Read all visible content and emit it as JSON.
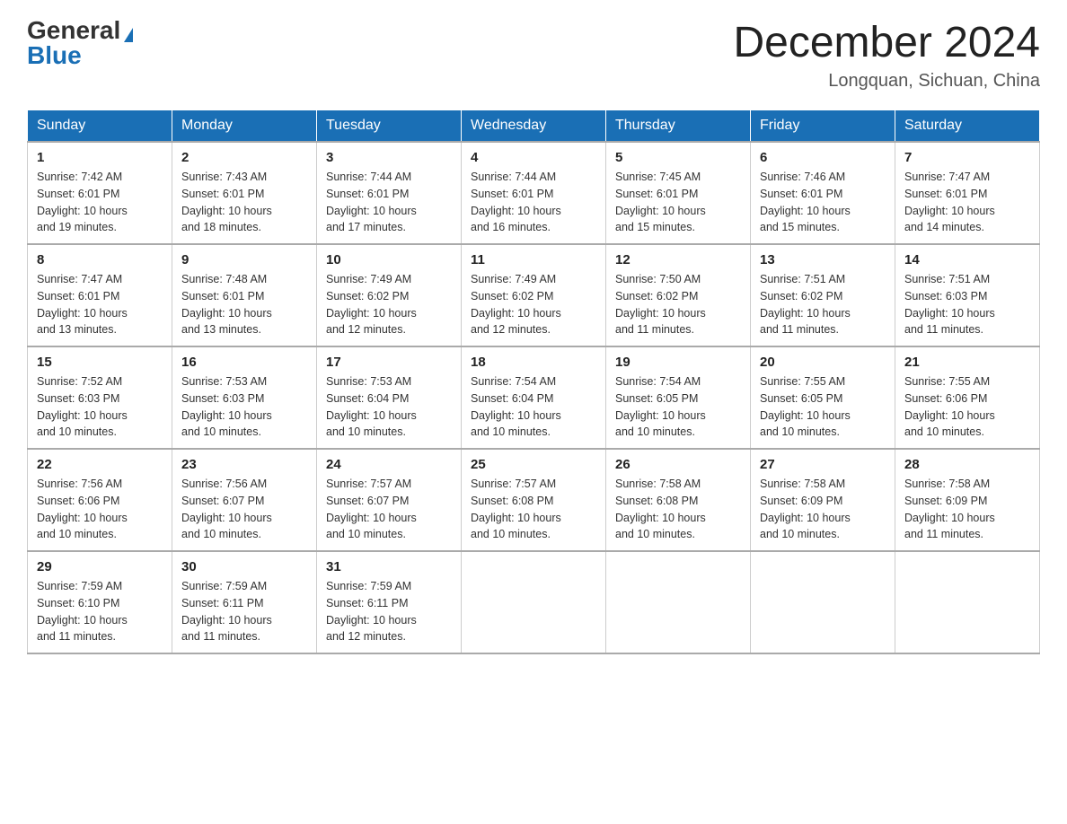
{
  "header": {
    "logo_general": "General",
    "logo_blue": "Blue",
    "month_title": "December 2024",
    "location": "Longquan, Sichuan, China"
  },
  "weekdays": [
    "Sunday",
    "Monday",
    "Tuesday",
    "Wednesday",
    "Thursday",
    "Friday",
    "Saturday"
  ],
  "weeks": [
    [
      {
        "day": "1",
        "sunrise": "7:42 AM",
        "sunset": "6:01 PM",
        "daylight": "10 hours and 19 minutes."
      },
      {
        "day": "2",
        "sunrise": "7:43 AM",
        "sunset": "6:01 PM",
        "daylight": "10 hours and 18 minutes."
      },
      {
        "day": "3",
        "sunrise": "7:44 AM",
        "sunset": "6:01 PM",
        "daylight": "10 hours and 17 minutes."
      },
      {
        "day": "4",
        "sunrise": "7:44 AM",
        "sunset": "6:01 PM",
        "daylight": "10 hours and 16 minutes."
      },
      {
        "day": "5",
        "sunrise": "7:45 AM",
        "sunset": "6:01 PM",
        "daylight": "10 hours and 15 minutes."
      },
      {
        "day": "6",
        "sunrise": "7:46 AM",
        "sunset": "6:01 PM",
        "daylight": "10 hours and 15 minutes."
      },
      {
        "day": "7",
        "sunrise": "7:47 AM",
        "sunset": "6:01 PM",
        "daylight": "10 hours and 14 minutes."
      }
    ],
    [
      {
        "day": "8",
        "sunrise": "7:47 AM",
        "sunset": "6:01 PM",
        "daylight": "10 hours and 13 minutes."
      },
      {
        "day": "9",
        "sunrise": "7:48 AM",
        "sunset": "6:01 PM",
        "daylight": "10 hours and 13 minutes."
      },
      {
        "day": "10",
        "sunrise": "7:49 AM",
        "sunset": "6:02 PM",
        "daylight": "10 hours and 12 minutes."
      },
      {
        "day": "11",
        "sunrise": "7:49 AM",
        "sunset": "6:02 PM",
        "daylight": "10 hours and 12 minutes."
      },
      {
        "day": "12",
        "sunrise": "7:50 AM",
        "sunset": "6:02 PM",
        "daylight": "10 hours and 11 minutes."
      },
      {
        "day": "13",
        "sunrise": "7:51 AM",
        "sunset": "6:02 PM",
        "daylight": "10 hours and 11 minutes."
      },
      {
        "day": "14",
        "sunrise": "7:51 AM",
        "sunset": "6:03 PM",
        "daylight": "10 hours and 11 minutes."
      }
    ],
    [
      {
        "day": "15",
        "sunrise": "7:52 AM",
        "sunset": "6:03 PM",
        "daylight": "10 hours and 10 minutes."
      },
      {
        "day": "16",
        "sunrise": "7:53 AM",
        "sunset": "6:03 PM",
        "daylight": "10 hours and 10 minutes."
      },
      {
        "day": "17",
        "sunrise": "7:53 AM",
        "sunset": "6:04 PM",
        "daylight": "10 hours and 10 minutes."
      },
      {
        "day": "18",
        "sunrise": "7:54 AM",
        "sunset": "6:04 PM",
        "daylight": "10 hours and 10 minutes."
      },
      {
        "day": "19",
        "sunrise": "7:54 AM",
        "sunset": "6:05 PM",
        "daylight": "10 hours and 10 minutes."
      },
      {
        "day": "20",
        "sunrise": "7:55 AM",
        "sunset": "6:05 PM",
        "daylight": "10 hours and 10 minutes."
      },
      {
        "day": "21",
        "sunrise": "7:55 AM",
        "sunset": "6:06 PM",
        "daylight": "10 hours and 10 minutes."
      }
    ],
    [
      {
        "day": "22",
        "sunrise": "7:56 AM",
        "sunset": "6:06 PM",
        "daylight": "10 hours and 10 minutes."
      },
      {
        "day": "23",
        "sunrise": "7:56 AM",
        "sunset": "6:07 PM",
        "daylight": "10 hours and 10 minutes."
      },
      {
        "day": "24",
        "sunrise": "7:57 AM",
        "sunset": "6:07 PM",
        "daylight": "10 hours and 10 minutes."
      },
      {
        "day": "25",
        "sunrise": "7:57 AM",
        "sunset": "6:08 PM",
        "daylight": "10 hours and 10 minutes."
      },
      {
        "day": "26",
        "sunrise": "7:58 AM",
        "sunset": "6:08 PM",
        "daylight": "10 hours and 10 minutes."
      },
      {
        "day": "27",
        "sunrise": "7:58 AM",
        "sunset": "6:09 PM",
        "daylight": "10 hours and 10 minutes."
      },
      {
        "day": "28",
        "sunrise": "7:58 AM",
        "sunset": "6:09 PM",
        "daylight": "10 hours and 11 minutes."
      }
    ],
    [
      {
        "day": "29",
        "sunrise": "7:59 AM",
        "sunset": "6:10 PM",
        "daylight": "10 hours and 11 minutes."
      },
      {
        "day": "30",
        "sunrise": "7:59 AM",
        "sunset": "6:11 PM",
        "daylight": "10 hours and 11 minutes."
      },
      {
        "day": "31",
        "sunrise": "7:59 AM",
        "sunset": "6:11 PM",
        "daylight": "10 hours and 12 minutes."
      },
      null,
      null,
      null,
      null
    ]
  ],
  "labels": {
    "sunrise_prefix": "Sunrise: ",
    "sunset_prefix": "Sunset: ",
    "daylight_prefix": "Daylight: "
  }
}
